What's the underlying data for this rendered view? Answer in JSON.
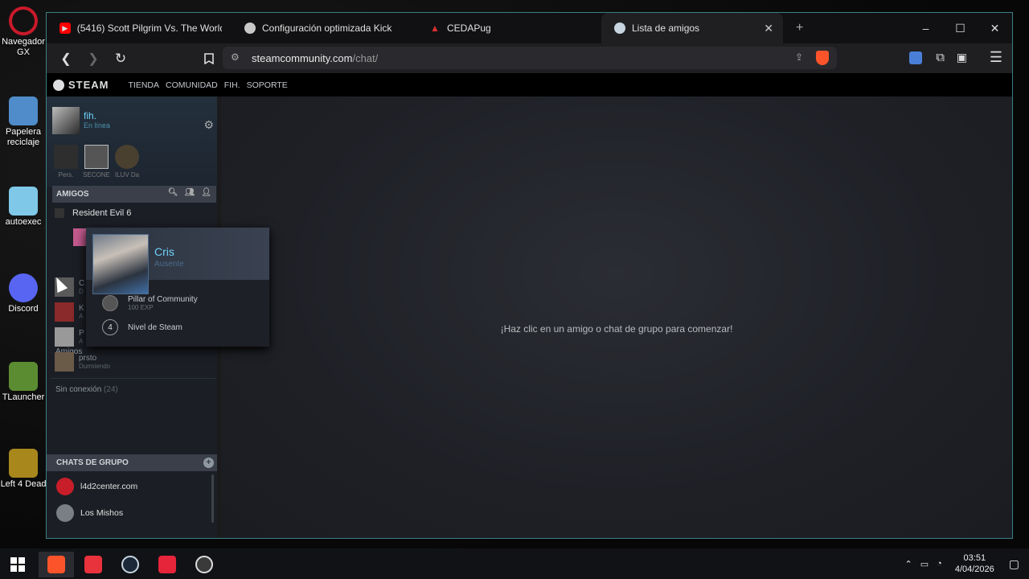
{
  "desktop": {
    "icons": [
      {
        "label": "Navegador GX",
        "color": "#c91a2a"
      },
      {
        "label": "Papelera reciclaje",
        "color": "#4f8cc9"
      },
      {
        "label": "autoexec",
        "color": "#7fc8e8"
      },
      {
        "label": "Discord",
        "color": "#5865f2"
      },
      {
        "label": "TLauncher",
        "color": "#5b8c32"
      },
      {
        "label": "Left 4 Dead",
        "color": "#a8871c"
      }
    ]
  },
  "browser": {
    "tabs": [
      {
        "title": "(5416) Scott Pilgrim Vs. The World - E",
        "icon": "youtube-icon",
        "color": "#ff0000"
      },
      {
        "title": "Configuración optimizada Kick",
        "icon": "chatgpt-icon",
        "color": "#c8c8c8"
      },
      {
        "title": "CEDAPug",
        "icon": "cedapug-icon",
        "color": "#d83030"
      },
      {
        "title": "Lista de amigos",
        "icon": "steam-icon",
        "color": "#c7d5e0"
      }
    ],
    "url": {
      "host": "steamcommunity.com",
      "path": "/chat/"
    },
    "new_tab": "+",
    "minimize": "–",
    "maximize": "☐",
    "close": "✕"
  },
  "steam": {
    "logo": "STEAM",
    "nav": [
      "TIENDA",
      "COMUNIDAD",
      "FIH.",
      "SOPORTE"
    ],
    "self": {
      "name": "fih.",
      "status": "En línea"
    },
    "mini_games": [
      "Pers.",
      "SECONE",
      "ILUV Da"
    ],
    "friends_header": "AMIGOS",
    "in_game": "Resident Evil 6",
    "group_label": "Amigos",
    "friends": [
      {
        "name": "C",
        "status": "D"
      },
      {
        "name": "K",
        "status": "A"
      },
      {
        "name": "P",
        "status": "A"
      },
      {
        "name": "prsto",
        "status": "Durmiendo"
      }
    ],
    "offline": {
      "label": "Sin conexión",
      "count": "(24)"
    },
    "chats_header": "CHATS DE GRUPO",
    "group_chats": [
      {
        "name": "l4d2center.com",
        "color": "#c81e2a"
      },
      {
        "name": "Los Mishos",
        "color": "#7a7f86"
      }
    ],
    "placeholder": "¡Haz clic en un amigo o chat de grupo para comenzar!"
  },
  "popup": {
    "name": "Cris",
    "status": "Ausente",
    "badge_title": "Pillar of Community",
    "badge_xp": "100 EXP",
    "level": "4",
    "level_label": "Nivel de Steam"
  },
  "taskbar": {
    "apps": [
      {
        "name": "brave-icon",
        "color": "#fb542b"
      },
      {
        "name": "opera-gx-icon",
        "color": "#e8323c"
      },
      {
        "name": "steam-icon",
        "color": "#1b2838"
      },
      {
        "name": "app-red-icon",
        "color": "#e6243a"
      },
      {
        "name": "obs-icon",
        "color": "#3a3a3a"
      }
    ],
    "time": "03:51",
    "date": "4/04/2026"
  }
}
